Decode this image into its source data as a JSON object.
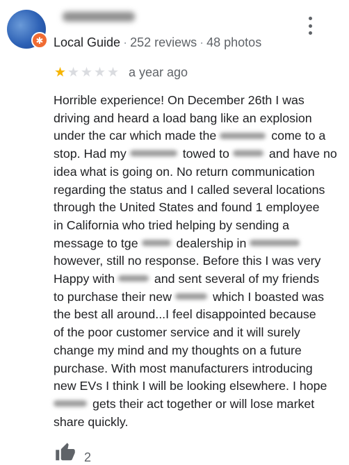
{
  "reviewer": {
    "avatar_badge_icon": "local-guide-badge-icon",
    "level": "Local Guide",
    "reviews": "252 reviews",
    "photos": "48 photos",
    "separator": "·"
  },
  "rating": {
    "value": 1,
    "max": 5,
    "star_color": "#f6b400",
    "empty_star_color": "#dadce0"
  },
  "date": "a year ago",
  "review_lines": [
    [
      "Horrible experience! On December 26th I was"
    ],
    [
      "driving and heard a load bang like an explosion"
    ],
    [
      "under the car which made the ",
      "come to a"
    ],
    [
      "stop. Had my ",
      "towed to ",
      "and have no"
    ],
    [
      "idea what is going on. No return communication"
    ],
    [
      "regarding the status and I called several locations"
    ],
    [
      "through the United States and found 1 employee"
    ],
    [
      "in California who tried helping by sending a"
    ],
    [
      "message to tge ",
      "dealership in "
    ],
    [
      "however,  still no response.  Before this I was very"
    ],
    [
      "Happy with ",
      "and sent several of my friends"
    ],
    [
      "to purchase their new ",
      "which I boasted was"
    ],
    [
      "the best all around...I feel disappointed because"
    ],
    [
      "of the poor customer service and it will surely"
    ],
    [
      "change my mind and my thoughts on a future"
    ],
    [
      "purchase. With most manufacturers introducing"
    ],
    [
      "new EVs I think I will be looking elsewhere. I hope"
    ],
    [
      "",
      "gets their act together or will lose market"
    ],
    [
      "share quickly."
    ]
  ],
  "likes": "2",
  "icons": {
    "more": "more-vert-icon",
    "thumb": "thumbs-up-icon"
  }
}
